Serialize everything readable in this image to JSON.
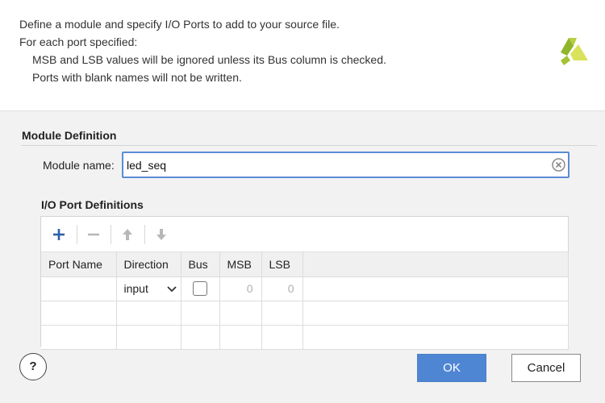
{
  "description": {
    "line1": "Define a module and specify I/O Ports to add to your source file.",
    "line2": "For each port specified:",
    "line3": "MSB and LSB values will be ignored unless its Bus column is checked.",
    "line4": "Ports with blank names will not be written."
  },
  "module_definition": {
    "title": "Module Definition",
    "name_label": "Module name:",
    "name_value": "led_seq"
  },
  "io_ports": {
    "title": "I/O Port Definitions",
    "columns": [
      "Port Name",
      "Direction",
      "Bus",
      "MSB",
      "LSB"
    ],
    "rows": [
      {
        "port_name": "",
        "direction": "input",
        "bus": false,
        "msb": "0",
        "lsb": "0"
      }
    ]
  },
  "buttons": {
    "help": "?",
    "ok": "OK",
    "cancel": "Cancel"
  },
  "colors": {
    "accent": "#4f86d4",
    "logo_green": "#8fb52c",
    "logo_yellow": "#d9e25a"
  }
}
